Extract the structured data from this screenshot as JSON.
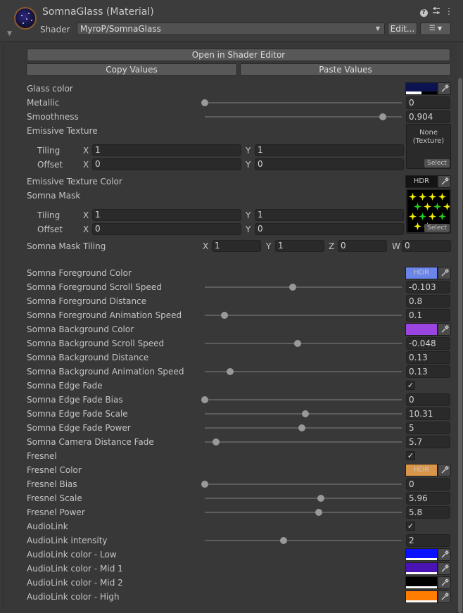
{
  "header": {
    "title": "SomnaGlass (Material)",
    "shader_label": "Shader",
    "shader_value": "MyroP/SomnaGlass",
    "edit_label": "Edit..."
  },
  "buttons": {
    "open_editor": "Open in Shader Editor",
    "copy": "Copy Values",
    "paste": "Paste Values"
  },
  "properties": {
    "glass_color": "Glass color",
    "metallic": {
      "label": "Metallic",
      "value": "0"
    },
    "smoothness": {
      "label": "Smoothness",
      "value": "0.904"
    },
    "emissive_texture": {
      "label": "Emissive Texture",
      "slot_text": "None\n(Texture)",
      "select": "Select",
      "tiling_label": "Tiling",
      "offset_label": "Offset",
      "tiling_x": "1",
      "tiling_y": "1",
      "offset_x": "0",
      "offset_y": "0"
    },
    "emissive_texture_color": {
      "label": "Emissive Texture Color",
      "hdr": "HDR"
    },
    "somna_mask": {
      "label": "Somna Mask",
      "select": "Select",
      "tiling_label": "Tiling",
      "offset_label": "Offset",
      "tiling_x": "1",
      "tiling_y": "1",
      "offset_x": "0",
      "offset_y": "0"
    },
    "somna_mask_tiling": {
      "label": "Somna Mask Tiling",
      "x": "1",
      "y": "1",
      "z": "0",
      "w": "0"
    },
    "axis": {
      "x": "X",
      "y": "Y",
      "z": "Z",
      "w": "W"
    },
    "fg_color": {
      "label": "Somna Foreground Color",
      "hdr": "HDR"
    },
    "fg_scroll": {
      "label": "Somna Foreground Scroll Speed",
      "value": "-0.103"
    },
    "fg_distance": {
      "label": "Somna Foreground Distance",
      "value": "0.8"
    },
    "fg_anim": {
      "label": "Somna Foreground Animation Speed",
      "value": "0.1"
    },
    "bg_color": {
      "label": "Somna Background Color"
    },
    "bg_scroll": {
      "label": "Somna Background Scroll Speed",
      "value": "-0.048"
    },
    "bg_distance": {
      "label": "Somna Background Distance",
      "value": "0.13"
    },
    "bg_anim": {
      "label": "Somna Background Animation Speed",
      "value": "0.13"
    },
    "edge_fade": {
      "label": "Somna Edge Fade"
    },
    "edge_fade_bias": {
      "label": "Somna Edge Fade Bias",
      "value": "0"
    },
    "edge_fade_scale": {
      "label": "Somna Edge Fade Scale",
      "value": "10.31"
    },
    "edge_fade_power": {
      "label": "Somna Edge Fade Power",
      "value": "5"
    },
    "camera_fade": {
      "label": "Somna Camera Distance Fade",
      "value": "5.7"
    },
    "fresnel": {
      "label": "Fresnel"
    },
    "fresnel_color": {
      "label": "Fresnel Color",
      "hdr": "HDR"
    },
    "fresnel_bias": {
      "label": "Fresnel Bias",
      "value": "0"
    },
    "fresnel_scale": {
      "label": "Fresnel Scale",
      "value": "5.96"
    },
    "fresnel_power": {
      "label": "Fresnel Power",
      "value": "5.8"
    },
    "audiolink": {
      "label": "AudioLink"
    },
    "audiolink_intensity": {
      "label": "AudioLink intensity",
      "value": "2"
    },
    "al_low": {
      "label": "AudioLink color - Low"
    },
    "al_mid1": {
      "label": "AudioLink color -  Mid 1"
    },
    "al_mid2": {
      "label": "AudioLink color - Mid 2"
    },
    "al_high": {
      "label": "AudioLink color - High"
    }
  },
  "slider_levels": {
    "metallic": 0.0,
    "smoothness": 0.904,
    "fg_scroll": 0.446,
    "fg_anim": 0.1,
    "bg_scroll": 0.473,
    "bg_anim": 0.13,
    "edge_fade_bias": 0.0,
    "edge_fade_scale": 0.509,
    "edge_fade_power": 0.494,
    "camera_fade": 0.057,
    "fresnel_bias": 0.0,
    "fresnel_scale": 0.588,
    "fresnel_power": 0.58,
    "audiolink_intensity": 0.4
  },
  "colors": {
    "glass": "#0b1450",
    "emissive": "#141414",
    "fg": "#6a84ea",
    "bg": "#9b45e0",
    "fresnel": "#d9964a",
    "al_low": "#0a12ff",
    "al_mid1": "#4a14b4",
    "al_mid2": "#000000",
    "al_high": "#ff7d00"
  },
  "icons": [
    "help-icon",
    "sliders-icon",
    "more-icon",
    "eyedropper-icon",
    "check-icon",
    "chevron-down-icon",
    "list-icon"
  ]
}
